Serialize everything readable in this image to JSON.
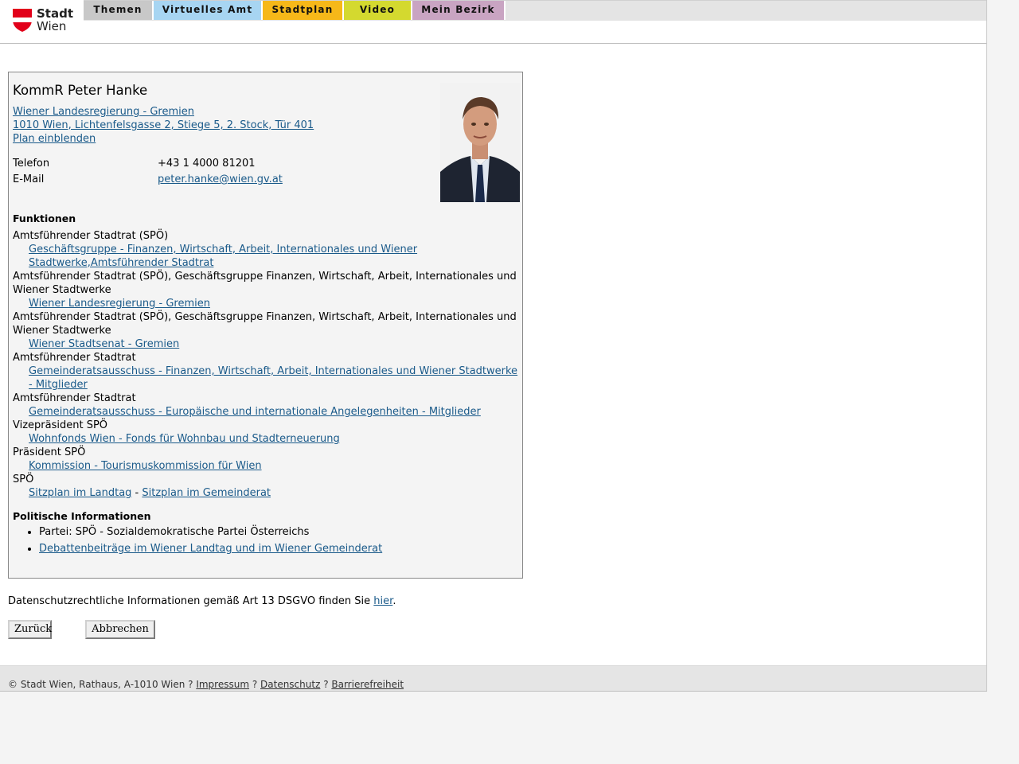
{
  "header": {
    "logo_line1": "Stadt",
    "logo_line2": "Wien",
    "tabs": [
      {
        "label": "Themen",
        "color": "#c8c8c8"
      },
      {
        "label": "Virtuelles Amt",
        "color": "#a7d5f2"
      },
      {
        "label": "Stadtplan",
        "color": "#f6b819"
      },
      {
        "label": "Video",
        "color": "#d4d92f"
      },
      {
        "label": "Mein Bezirk",
        "color": "#c9a4c2"
      }
    ]
  },
  "person": {
    "name": "KommR Peter Hanke",
    "org_link": "Wiener Landesregierung - Gremien ",
    "address_link": "1010 Wien, Lichtenfelsgasse 2, Stiege 5, 2. Stock, Tür 401",
    "map_link": "Plan einblenden",
    "phone_label": "Telefon",
    "phone_value": "+43 1 4000 81201",
    "email_label": "E-Mail",
    "email_value": "peter.hanke@wien.gv.at"
  },
  "functions": {
    "heading": "Funktionen",
    "rows": [
      {
        "role": "Amtsführender Stadtrat (SPÖ)",
        "link": "Geschäftsgruppe - Finanzen, Wirtschaft, Arbeit, Internationales und Wiener Stadtwerke,Amtsführender Stadtrat"
      },
      {
        "role": "Amtsführender Stadtrat (SPÖ), Geschäftsgruppe Finanzen, Wirtschaft, Arbeit, Internationales und Wiener Stadtwerke",
        "link": "Wiener Landesregierung - Gremien"
      },
      {
        "role": "Amtsführender Stadtrat (SPÖ), Geschäftsgruppe Finanzen, Wirtschaft, Arbeit, Internationales und Wiener Stadtwerke",
        "link": "Wiener Stadtsenat - Gremien"
      },
      {
        "role": "Amtsführender Stadtrat",
        "link": "Gemeinderatsausschuss - Finanzen, Wirtschaft, Arbeit, Internationales und Wiener Stadtwerke - Mitglieder"
      },
      {
        "role": "Amtsführender Stadtrat",
        "link": "Gemeinderatsausschuss - Europäische und internationale Angelegenheiten - Mitglieder"
      },
      {
        "role": "Vizepräsident SPÖ",
        "link": "Wohnfonds Wien - Fonds für Wohnbau und Stadterneuerung"
      },
      {
        "role": "Präsident SPÖ",
        "link": "Kommission - Tourismuskommission für Wien"
      }
    ],
    "last_role": "SPÖ",
    "seat_landtag": "Sitzplan im Landtag",
    "seat_separator": " - ",
    "seat_gemeinderat": "Sitzplan im Gemeinderat"
  },
  "political": {
    "heading": "Politische Informationen",
    "party": "Partei: SPÖ - Sozialdemokratische Partei Österreichs",
    "debates_link": "Debattenbeiträge im Wiener Landtag und im Wiener Gemeinderat"
  },
  "privacy": {
    "text": "Datenschutzrechtliche Informationen gemäß Art 13 DSGVO finden Sie ",
    "link": "hier",
    "end": "."
  },
  "buttons": {
    "back": "Zurück",
    "cancel": "Abbrechen"
  },
  "footer": {
    "copyright": "© Stadt Wien, Rathaus, A-1010 Wien ? ",
    "impressum": "Impressum",
    "sep": " ? ",
    "datenschutz": "Datenschutz",
    "barriere": "Barrierefreiheit"
  }
}
